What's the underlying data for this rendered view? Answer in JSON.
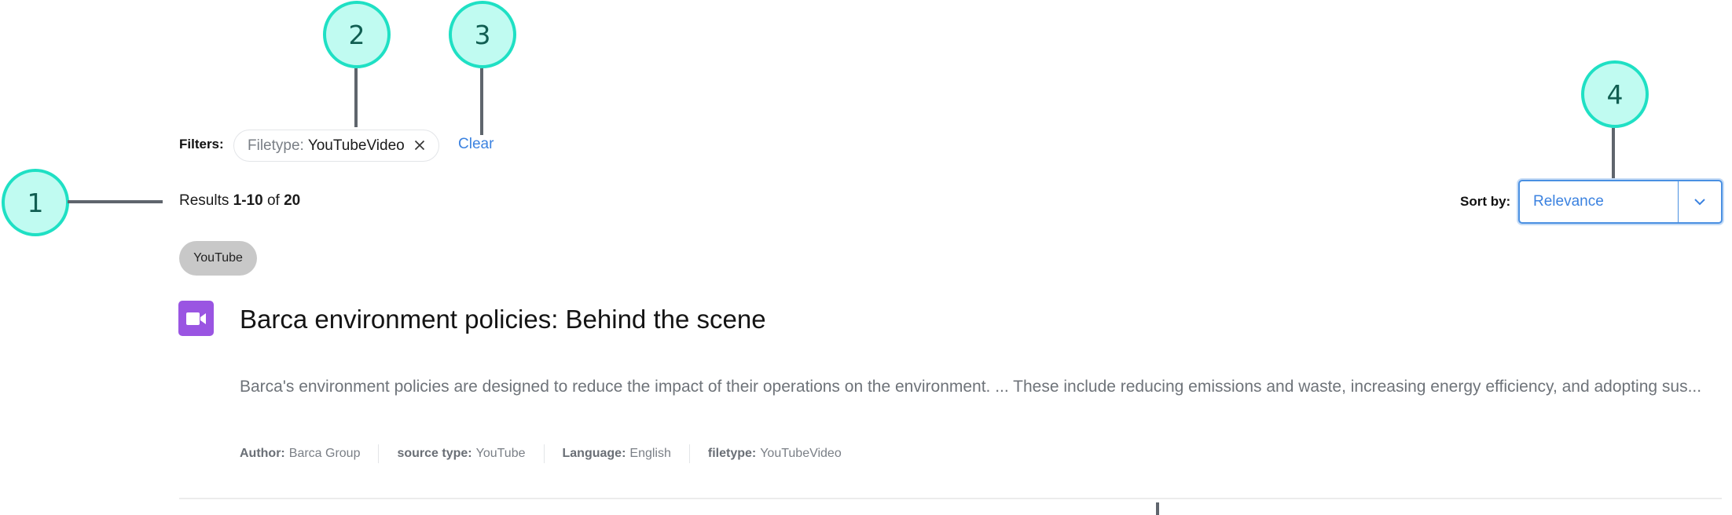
{
  "callouts": [
    {
      "number": "1",
      "target": "results-count"
    },
    {
      "number": "2",
      "target": "filter-chip"
    },
    {
      "number": "3",
      "target": "clear-filters"
    },
    {
      "number": "4",
      "target": "sort-select"
    }
  ],
  "filters": {
    "label": "Filters:",
    "chips": [
      {
        "key": "Filetype:",
        "value": "YouTubeVideo",
        "remove_icon": "close-icon"
      }
    ],
    "clear_label": "Clear"
  },
  "results": {
    "prefix": "Results",
    "range": "1-10",
    "of": "of",
    "total": "20"
  },
  "sort": {
    "label": "Sort by:",
    "selected": "Relevance",
    "icon": "chevron-down-icon"
  },
  "items": [
    {
      "badge": "YouTube",
      "icon": "video-camera-icon",
      "title": "Barca environment policies: Behind the scene",
      "description": "Barca's environment policies are designed to reduce the impact of their operations on the environment. ... These include reducing emissions and waste, increasing energy efficiency, and adopting sus...",
      "meta": [
        {
          "label": "Author:",
          "value": "Barca Group"
        },
        {
          "label": "source type:",
          "value": "YouTube"
        },
        {
          "label": "Language:",
          "value": "English"
        },
        {
          "label": "filetype:",
          "value": "YouTubeVideo"
        }
      ]
    }
  ],
  "colors": {
    "accent": "#3b82e0",
    "callout_fill": "#c0fbf1",
    "callout_border": "#1fe0c4",
    "video_icon": "#9a55e2",
    "badge_bg": "#c8c8c8"
  }
}
